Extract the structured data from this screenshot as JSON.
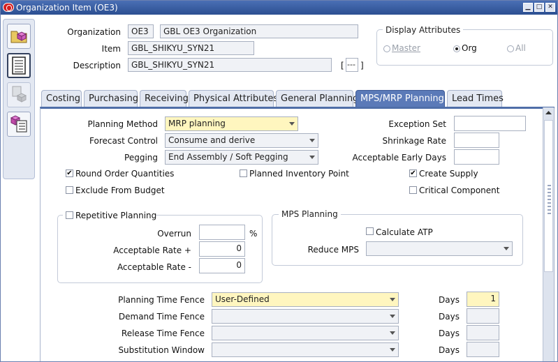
{
  "window": {
    "title": "Organization Item (OE3)"
  },
  "header": {
    "organization_label": "Organization",
    "organization_code": "OE3",
    "organization_name": "GBL OE3 Organization",
    "item_label": "Item",
    "item_value": "GBL_SHIKYU_SYN21",
    "description_label": "Description",
    "description_value": "GBL_SHIKYU_SYN21",
    "flex_open": "[",
    "flex_value": "---",
    "flex_close": "]"
  },
  "display_attributes": {
    "title": "Display Attributes",
    "options": [
      {
        "label": "Master",
        "selected": false,
        "enabled": false
      },
      {
        "label": "Org",
        "selected": true,
        "enabled": true
      },
      {
        "label": "All",
        "selected": false,
        "enabled": false
      }
    ]
  },
  "tabs": [
    {
      "label": "Costing",
      "selected": false
    },
    {
      "label": "Purchasing",
      "selected": false
    },
    {
      "label": "Receiving",
      "selected": false
    },
    {
      "label": "Physical Attributes",
      "selected": false
    },
    {
      "label": "General Planning",
      "selected": false
    },
    {
      "label": "MPS/MRP Planning",
      "selected": true
    },
    {
      "label": "Lead Times",
      "selected": false
    }
  ],
  "form": {
    "planning_method_label": "Planning Method",
    "planning_method_value": "MRP planning",
    "forecast_control_label": "Forecast Control",
    "forecast_control_value": "Consume and derive",
    "pegging_label": "Pegging",
    "pegging_value": "End Assembly / Soft Pegging",
    "exception_set_label": "Exception Set",
    "exception_set_value": "",
    "shrinkage_rate_label": "Shrinkage Rate",
    "shrinkage_rate_value": "",
    "acceptable_early_days_label": "Acceptable Early Days",
    "acceptable_early_days_value": "",
    "round_order_label": "Round Order Quantities",
    "round_order_checked": true,
    "planned_inventory_label": "Planned Inventory Point",
    "planned_inventory_checked": false,
    "create_supply_label": "Create Supply",
    "create_supply_checked": true,
    "exclude_budget_label": "Exclude From Budget",
    "exclude_budget_checked": false,
    "critical_component_label": "Critical Component",
    "critical_component_checked": false
  },
  "repetitive": {
    "title": "Repetitive Planning",
    "checked": false,
    "overrun_label": "Overrun",
    "overrun_value": "",
    "percent": "%",
    "rate_plus_label": "Acceptable Rate +",
    "rate_plus_value": "0",
    "rate_minus_label": "Acceptable Rate -",
    "rate_minus_value": "0"
  },
  "mps": {
    "title": "MPS Planning",
    "calc_atp_label": "Calculate ATP",
    "calc_atp_checked": false,
    "reduce_mps_label": "Reduce MPS",
    "reduce_mps_value": ""
  },
  "time_fences": {
    "days_label": "Days",
    "rows": [
      {
        "label": "Planning Time Fence",
        "value": "User-Defined",
        "days": "1"
      },
      {
        "label": "Demand Time Fence",
        "value": "",
        "days": ""
      },
      {
        "label": "Release Time Fence",
        "value": "",
        "days": ""
      },
      {
        "label": "Substitution Window",
        "value": "",
        "days": ""
      }
    ]
  },
  "toolbar_icons": [
    "open-folder-icon",
    "item-list-icon",
    "copy-item-icon",
    "item-attributes-icon"
  ],
  "colors": {
    "titlebar": "#2c4f91",
    "selected_tab": "#5b7ab8",
    "required_field": "#fff6bf"
  }
}
